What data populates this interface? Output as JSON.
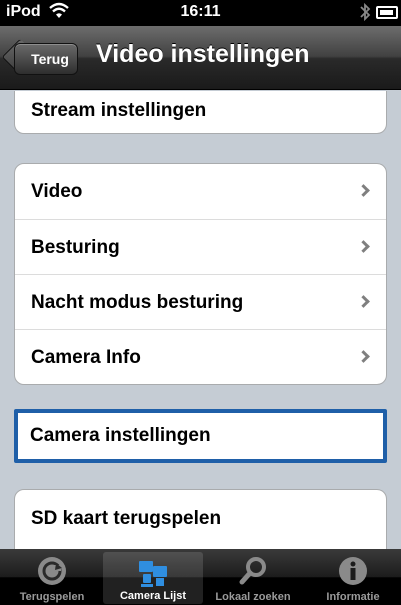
{
  "status_bar": {
    "carrier": "iPod",
    "time": "16:11",
    "wifi_icon": "wifi-icon",
    "bluetooth_icon": "bluetooth-icon",
    "battery_icon": "battery-icon"
  },
  "nav": {
    "back_label": "Terug",
    "title": "Video instellingen"
  },
  "groups": {
    "stream": {
      "label": "Stream instellingen"
    },
    "main": {
      "items": [
        {
          "label": "Video"
        },
        {
          "label": "Besturing"
        },
        {
          "label": "Nacht modus besturing"
        },
        {
          "label": "Camera Info"
        }
      ]
    },
    "camera": {
      "label": "Camera instellingen"
    },
    "sd": {
      "label": "SD kaart terugspelen"
    }
  },
  "tabs": [
    {
      "label": "Terugspelen",
      "icon": "playback-icon",
      "selected": false
    },
    {
      "label": "Camera Lijst",
      "icon": "camera-list-icon",
      "selected": true
    },
    {
      "label": "Lokaal zoeken",
      "icon": "search-icon",
      "selected": false
    },
    {
      "label": "Informatie",
      "icon": "info-icon",
      "selected": false
    }
  ],
  "colors": {
    "selection_border": "#1f5fa8",
    "background": "#c5ccd4"
  }
}
